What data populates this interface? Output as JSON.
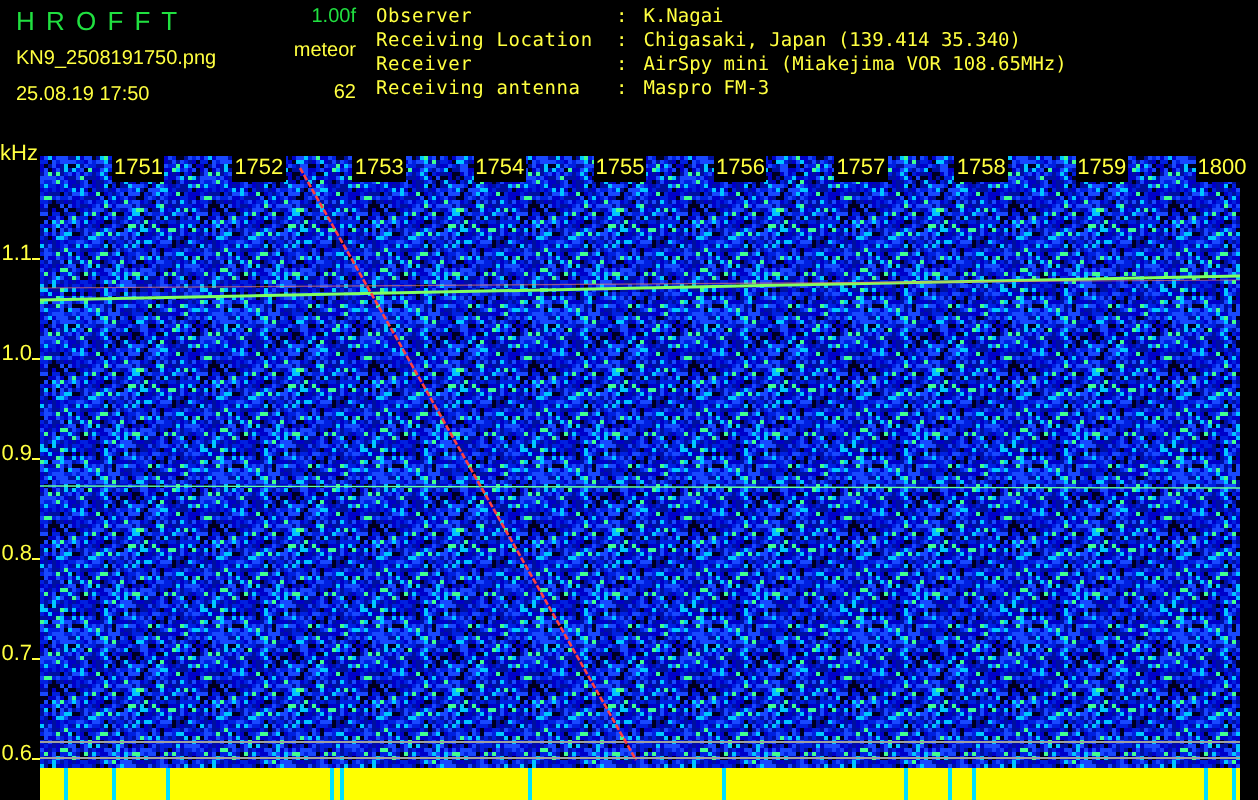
{
  "header": {
    "app_title": "H R O F F T",
    "version": "1.00f",
    "file_name": "KN9_2508191750.png",
    "timestamp": "25.08.19 17:50",
    "count_label": "meteor",
    "count": "62"
  },
  "info": [
    {
      "label": "Observer",
      "separator": ":",
      "value": "K.Nagai"
    },
    {
      "label": "Receiving Location",
      "separator": ":",
      "value": "Chigasaki, Japan (139.414 35.340)"
    },
    {
      "label": "Receiver",
      "separator": ":",
      "value": "AirSpy mini (Miakejima VOR 108.65MHz)"
    },
    {
      "label": "Receiving antenna",
      "separator": ":",
      "value": "Maspro FM-3"
    }
  ],
  "plot": {
    "unit": "kHz",
    "x_labels": [
      "1751",
      "1752",
      "1753",
      "1754",
      "1755",
      "1756",
      "1757",
      "1758",
      "1759",
      "1800"
    ],
    "y_labels": [
      "1.1",
      "1.0",
      "0.9",
      "0.8",
      "0.7",
      "0.6"
    ]
  }
}
